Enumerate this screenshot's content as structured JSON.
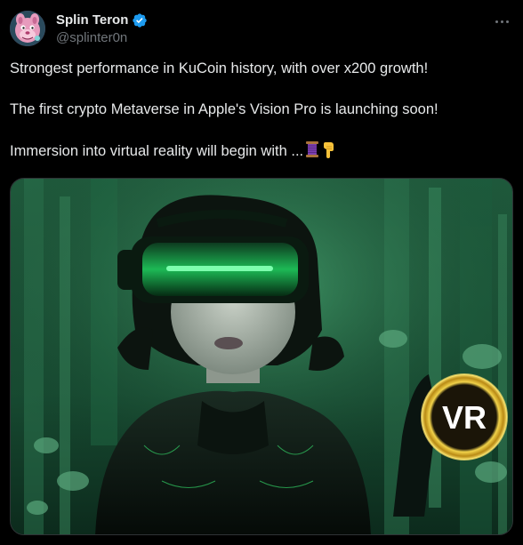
{
  "author": {
    "display_name": "Splin Teron",
    "handle": "@splinter0n",
    "verified": true,
    "avatar_icon": "pink-panther-avatar"
  },
  "menu": {
    "icon": "more-options-icon"
  },
  "tweet": {
    "lines": [
      "Strongest performance in KuCoin history, with over x200 growth!",
      "The first crypto Metaverse in Apple's Vision Pro is launching soon!",
      "Immersion into virtual reality will begin with ..."
    ],
    "emojis": [
      "spool-of-thread-emoji",
      "backhand-index-pointing-down-emoji"
    ]
  },
  "media": {
    "badge_text": "VR",
    "image_icon": "vr-headset-woman-illustration"
  },
  "colors": {
    "background": "#000000",
    "text": "#e7e9ea",
    "secondary": "#71767b",
    "verified": "#1d9bf0",
    "accent_green": "#3cff7a",
    "badge_gold": "#e8c22a"
  }
}
